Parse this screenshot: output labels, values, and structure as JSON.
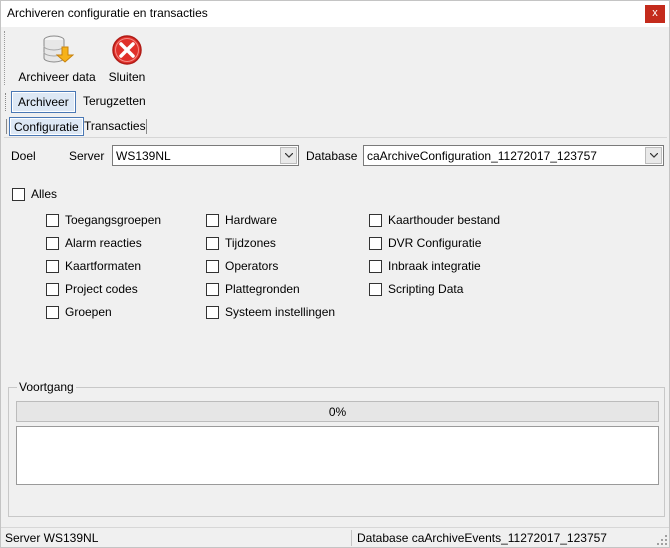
{
  "window": {
    "title": "Archiveren configuratie en transacties",
    "close_label": "x"
  },
  "toolbar": {
    "archive_data_label": "Archiveer data",
    "close_label": "Sluiten",
    "archive_icon": "database-archive-icon",
    "close_icon": "red-x-circle-icon"
  },
  "mode_tabs": {
    "archive": "Archiveer",
    "restore": "Terugzetten"
  },
  "sub_tabs": {
    "configuration": "Configuratie",
    "transactions": "Transacties"
  },
  "target": {
    "label": "Doel",
    "server_label": "Server",
    "server_value": "WS139NL",
    "database_label": "Database",
    "database_value": "caArchiveConfiguration_11272017_123757"
  },
  "all_label": "Alles",
  "checkboxes": {
    "col1": [
      "Toegangsgroepen",
      "Alarm reacties",
      "Kaartformaten",
      "Project codes",
      "Groepen"
    ],
    "col2": [
      "Hardware",
      "Tijdzones",
      "Operators",
      "Plattegronden",
      "Systeem instellingen"
    ],
    "col3": [
      "Kaarthouder bestand",
      "DVR Configuratie",
      "Inbraak integratie",
      "Scripting Data"
    ]
  },
  "progress": {
    "legend": "Voortgang",
    "value_text": "0%",
    "value": 0
  },
  "status": {
    "server": "Server WS139NL",
    "database": "Database caArchiveEvents_11272017_123757"
  },
  "colors": {
    "close_red": "#c42b1c",
    "tab_active_bg": "#dde8f5",
    "tab_active_border": "#4a78b5",
    "progress_fill": "#06b025"
  }
}
